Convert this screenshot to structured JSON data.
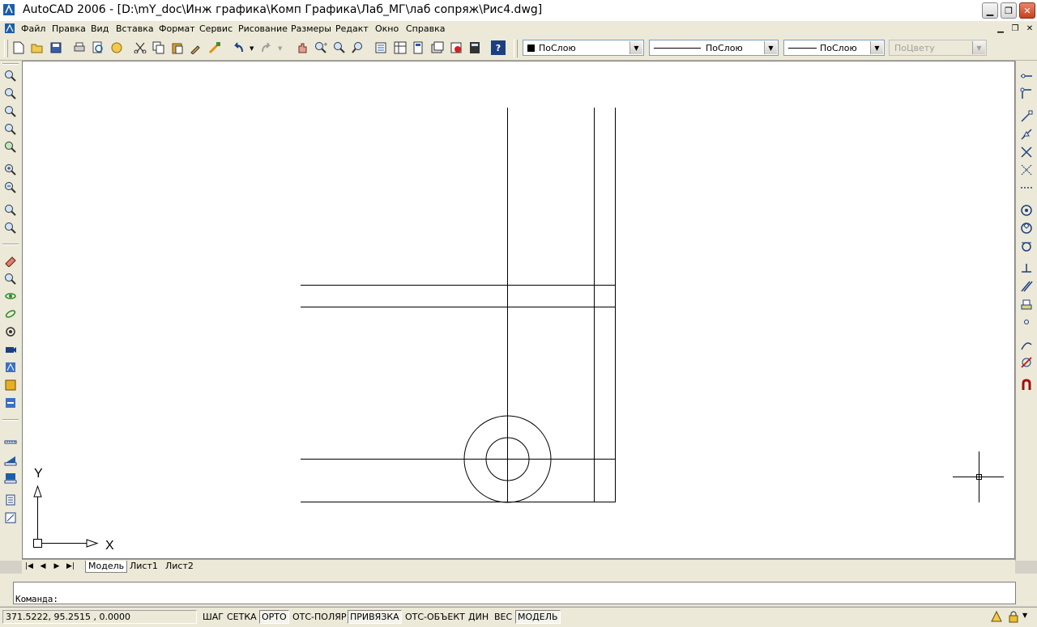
{
  "window": {
    "title": "AutoCAD 2006 - [D:\\mY_doc\\Инж графика\\Комп Графика\\Лаб_МГ\\лаб сопряж\\Рис4.dwg]"
  },
  "menu": {
    "items": [
      "Файл",
      "Правка",
      "Вид",
      "Вставка",
      "Формат",
      "Сервис",
      "Рисование",
      "Размеры",
      "Редакт",
      "Окно",
      "Справка"
    ]
  },
  "properties": {
    "color": "ПоСлою",
    "linetype": "ПоСлою",
    "lineweight": "ПоСлою",
    "plotstyle": "ПоЦвету"
  },
  "ucs": {
    "x_label": "X",
    "y_label": "Y"
  },
  "tabs": [
    "Модель",
    "Лист1",
    "Лист2"
  ],
  "command": {
    "prompt": "Команда:"
  },
  "status": {
    "coords": "371.5222, 95.2515 , 0.0000",
    "toggles": [
      {
        "label": "ШАГ",
        "on": false
      },
      {
        "label": "СЕТКА",
        "on": false
      },
      {
        "label": "ОРТО",
        "on": true
      },
      {
        "label": "ОТС-ПОЛЯР",
        "on": false
      },
      {
        "label": "ПРИВЯЗКА",
        "on": true
      },
      {
        "label": "ОТС-ОБЪЕКТ",
        "on": false
      },
      {
        "label": "ДИН",
        "on": false
      },
      {
        "label": "ВЕС",
        "on": false
      },
      {
        "label": "МОДЕЛЬ",
        "on": true
      }
    ]
  },
  "colors": {
    "drawing_bg": "#ffffff",
    "chrome": "#ece9d8",
    "accent": "#1c5fa8"
  }
}
